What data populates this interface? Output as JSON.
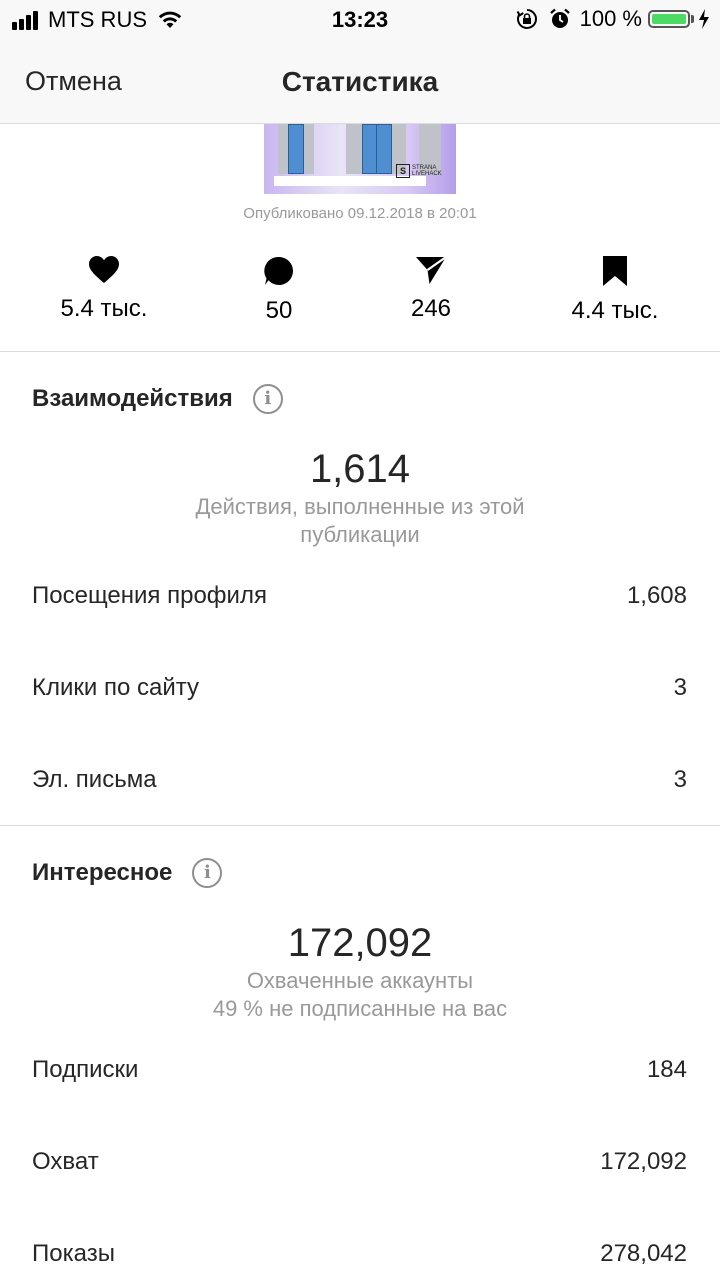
{
  "status_bar": {
    "carrier": "MTS RUS",
    "time": "13:23",
    "battery": "100 %"
  },
  "nav": {
    "cancel": "Отмена",
    "title": "Статистика"
  },
  "post": {
    "logo_letter": "S",
    "logo_text_1": "STRANA",
    "logo_text_2": "LIVEHACK",
    "published": "Опубликовано 09.12.2018 в 20:01"
  },
  "counters": {
    "likes": "5.4 тыс.",
    "comments": "50",
    "shares": "246",
    "saves": "4.4 тыс."
  },
  "interactions": {
    "title": "Взаимодействия",
    "total": "1,614",
    "caption": "Действия, выполненные из этой публикации",
    "rows": [
      {
        "label": "Посещения профиля",
        "value": "1,608"
      },
      {
        "label": "Клики по сайту",
        "value": "3"
      },
      {
        "label": "Эл. письма",
        "value": "3"
      }
    ]
  },
  "discovery": {
    "title": "Интересное",
    "total": "172,092",
    "caption": "Охваченные аккаунты",
    "caption2": "49 % не подписанные на вас",
    "rows": [
      {
        "label": "Подписки",
        "value": "184"
      },
      {
        "label": "Охват",
        "value": "172,092"
      },
      {
        "label": "Показы",
        "value": "278,042"
      }
    ]
  },
  "colors": {
    "battery": "#4cd964",
    "text": "#262626",
    "muted": "#999999"
  }
}
